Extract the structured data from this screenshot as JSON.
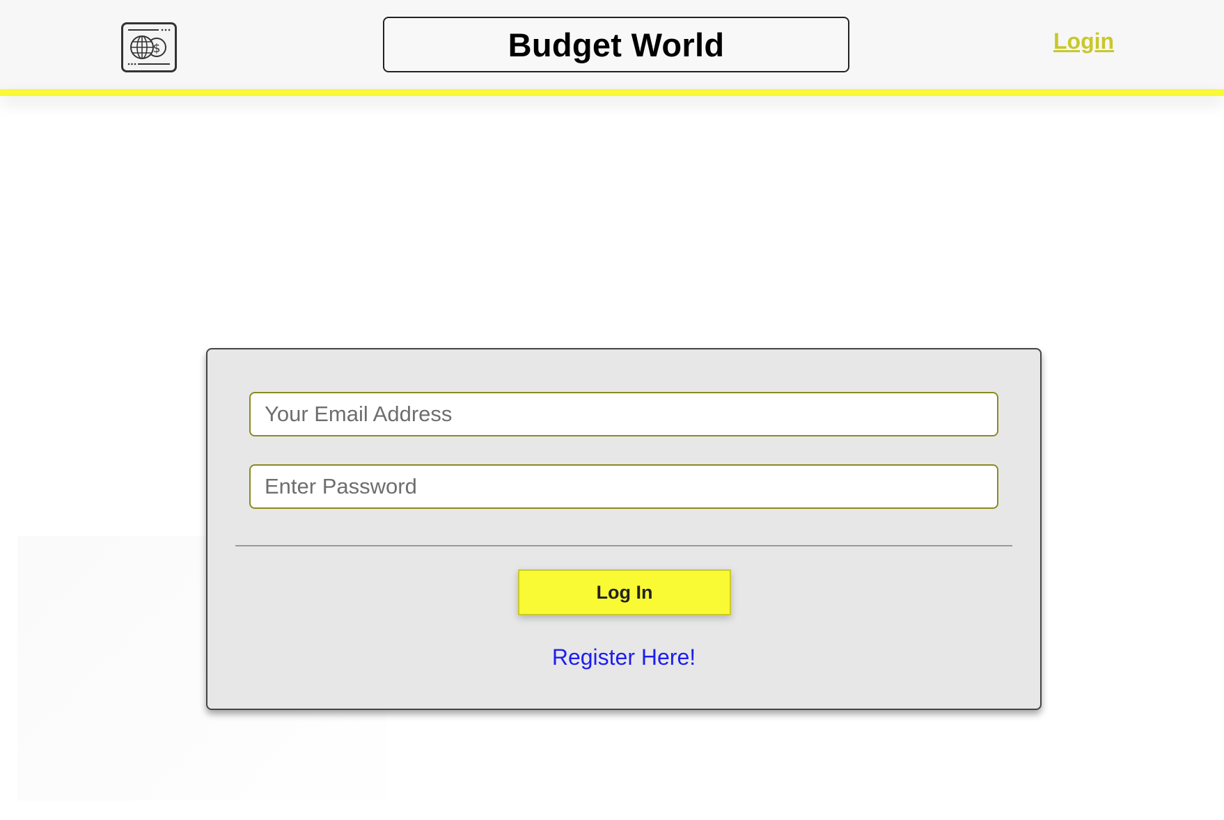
{
  "header": {
    "logo_icon": "globe-dollar-card-icon",
    "title": "Budget World",
    "nav_login_label": "Login"
  },
  "login_form": {
    "email_placeholder": "Your Email Address",
    "password_placeholder": "Enter Password",
    "submit_label": "Log In",
    "register_link": "Register Here!"
  },
  "colors": {
    "accent_yellow": "#f9f934",
    "login_link": "#c8c82a",
    "field_border": "#8a8a1e",
    "register_link": "#1d1df0",
    "card_background": "#e7e7e7",
    "header_background": "#f7f7f7"
  }
}
